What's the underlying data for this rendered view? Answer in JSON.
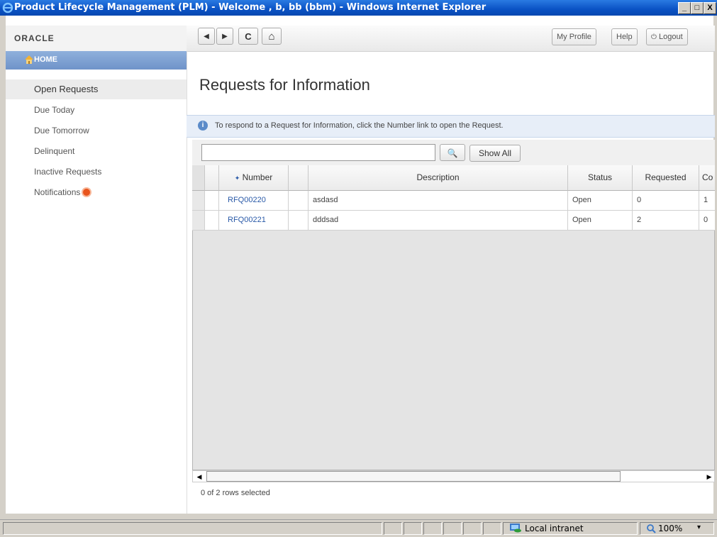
{
  "window": {
    "title": "Product Lifecycle Management (PLM) - Welcome , b, bb (bbm) - Windows Internet Explorer",
    "minimize": "_",
    "maximize": "□",
    "close": "X"
  },
  "header": {
    "logo": "ORACLE",
    "nav_back": "◀",
    "nav_forward": "▶",
    "nav_refresh": "C",
    "nav_home": "⌂",
    "my_profile": "My Profile",
    "help": "Help",
    "logout": "Logout",
    "logout_icon": "⏻"
  },
  "sidebar": {
    "home_label": "HOME",
    "items": [
      {
        "label": "Open Requests",
        "active": true
      },
      {
        "label": "Due Today"
      },
      {
        "label": "Due Tomorrow"
      },
      {
        "label": "Delinquent"
      },
      {
        "label": "Inactive Requests"
      },
      {
        "label": "Notifications"
      }
    ]
  },
  "main": {
    "title": "Requests for Information",
    "info_icon": "i",
    "info_text": "To respond to a Request for Information, click the Number link to open the Request.",
    "search_value": "",
    "search_icon": "🔍",
    "show_all": "Show All",
    "table": {
      "columns": [
        "Number",
        "Description",
        "Status",
        "Requested",
        "Co"
      ],
      "sort_indicator": "✦",
      "rows": [
        {
          "number": "RFQ00220",
          "description": "asdasd",
          "status": "Open",
          "requested": "0",
          "co": "1"
        },
        {
          "number": "RFQ00221",
          "description": "dddsad",
          "status": "Open",
          "requested": "2",
          "co": "0"
        }
      ]
    },
    "scroll_left": "◀",
    "scroll_right": "▶",
    "rows_selected": "0 of 2 rows selected"
  },
  "statusbar": {
    "zone": "Local intranet",
    "zoom": "100%",
    "zoom_dropdown": "▾"
  }
}
